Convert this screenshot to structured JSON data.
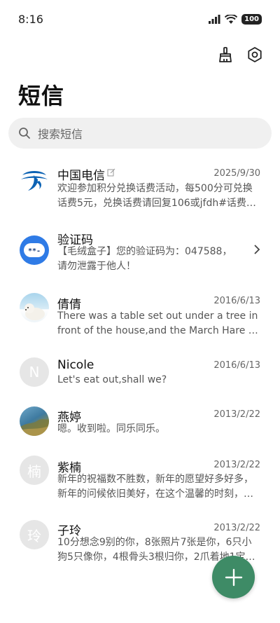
{
  "status_bar": {
    "time": "8:16",
    "battery": "100"
  },
  "header": {
    "title": "短信"
  },
  "search": {
    "placeholder": "搜索短信"
  },
  "conversations": [
    {
      "name": "中国电信",
      "date": "2025/9/30",
      "line1": "欢迎参加积分兑换话费活动，每500分可兑换",
      "line2": "话费5元，兑换话费请回复106或jfdh#话费…"
    },
    {
      "name": "验证码",
      "date": "",
      "line1": "【毛绒盒子】您的验证码为：047588，",
      "line2": "请勿泄露于他人！"
    },
    {
      "name": "倩倩",
      "date": "2016/6/13",
      "line1": "There was a table set out under a tree in",
      "line2": "front of the house,and the March Hare an…"
    },
    {
      "name": "Nicole",
      "date": "2016/6/13",
      "line1": "Let's eat out,shall we?",
      "line2": "",
      "avatar_letter": "N"
    },
    {
      "name": "燕婷",
      "date": "2013/2/22",
      "line1": "嗯。收到啦。同乐同乐。",
      "line2": ""
    },
    {
      "name": "紫楠",
      "date": "2013/2/22",
      "line1": "新年的祝福数不胜数，新年的愿望好多好多，",
      "line2": "新年的问候依旧美好，在这个温馨的时刻，…",
      "avatar_letter": "楠"
    },
    {
      "name": "子玲",
      "date": "2013/2/22",
      "line1": "10分想念9别的你，8张照片7张是你，6只小",
      "line2": "狗5只像你，4根骨头3根归你，2爪着地1宝…",
      "avatar_letter": "玲"
    }
  ],
  "colors": {
    "fab": "#3e8b66",
    "telecom_blue": "#0b62b4",
    "verify_blue": "#2f7be6"
  }
}
